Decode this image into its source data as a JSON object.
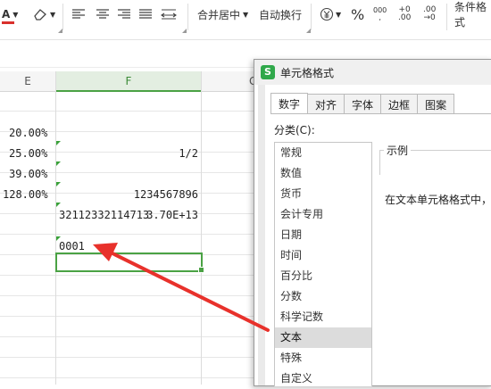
{
  "ribbon": {
    "merge_center": "合并居中",
    "auto_wrap": "自动换行",
    "conditional_format": "条件格式",
    "percent_symbol": "%",
    "thousands_symbol": "000",
    "inc_decimal_top": "+0",
    "inc_decimal_bottom": ".00",
    "dec_decimal_top": ".00",
    "dec_decimal_bottom": "→0"
  },
  "columns": {
    "e": "E",
    "f": "F",
    "g": "G"
  },
  "cells": {
    "e1": "20.00%",
    "e2": "25.00%",
    "e3": "39.00%",
    "e4": "128.00%",
    "f2": "1/2",
    "f4": "1234567896",
    "f5": "3.70E+13",
    "f6": "32112332114713",
    "f8": "0001"
  },
  "dialog": {
    "title": "单元格格式",
    "tabs": [
      "数字",
      "对齐",
      "字体",
      "边框",
      "图案"
    ],
    "category_label": "分类(C):",
    "categories": [
      "常规",
      "数值",
      "货币",
      "会计专用",
      "日期",
      "时间",
      "百分比",
      "分数",
      "科学记数",
      "文本",
      "特殊",
      "自定义"
    ],
    "selected_category": "文本",
    "sample_label": "示例",
    "description": "在文本单元格格式中，"
  },
  "colors": {
    "accent_green": "#4aa244",
    "arrow_red": "#e8312b",
    "font_red": "#d9302c"
  }
}
